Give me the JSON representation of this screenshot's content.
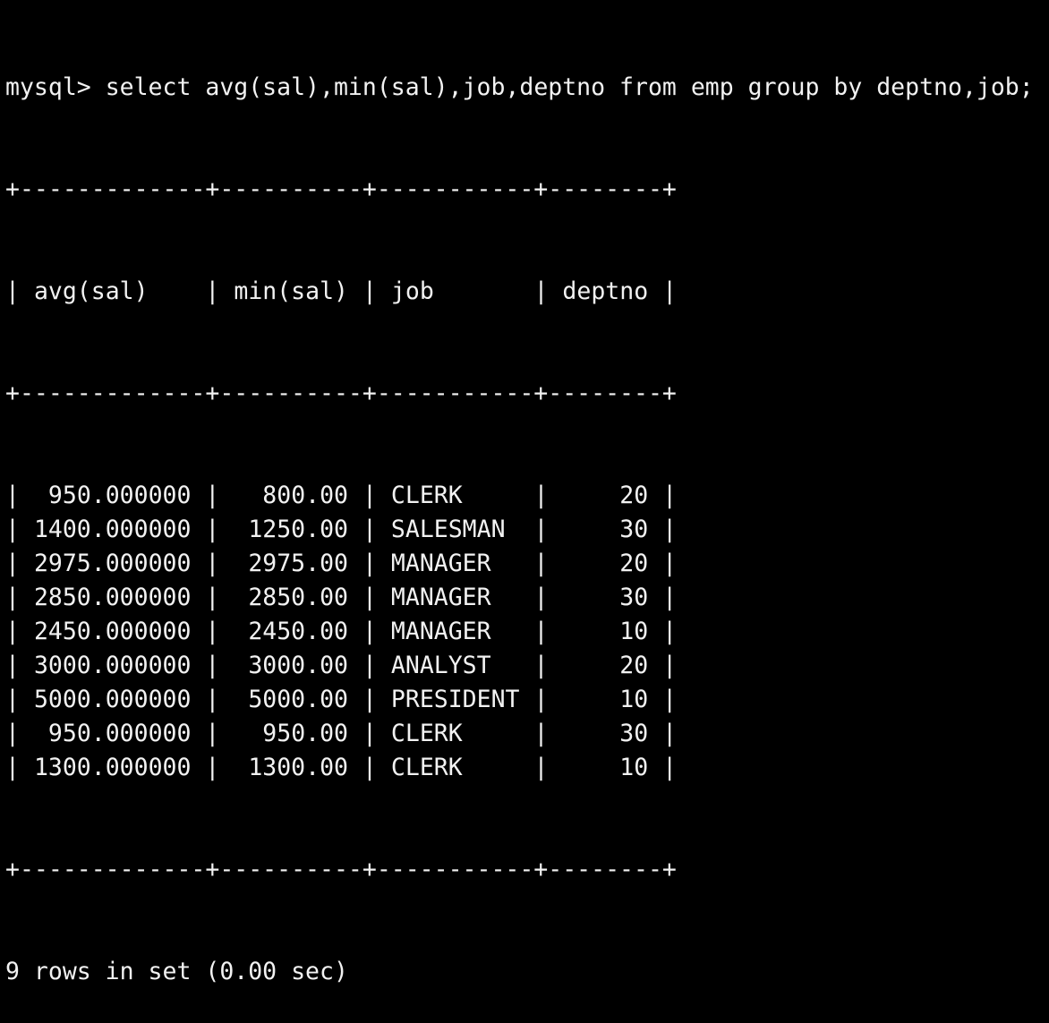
{
  "terminal": {
    "prompt": "mysql> ",
    "command": "select avg(sal),min(sal),job,deptno from emp group by deptno,job;",
    "border": "+-------------+----------+-----------+--------+",
    "columns": [
      "avg(sal)",
      "min(sal)",
      "job",
      "deptno"
    ],
    "column_widths": [
      11,
      8,
      9,
      6
    ],
    "column_align": [
      "right",
      "right",
      "left",
      "right"
    ],
    "rows": [
      [
        "950.000000",
        "800.00",
        "CLERK",
        "20"
      ],
      [
        "1400.000000",
        "1250.00",
        "SALESMAN",
        "30"
      ],
      [
        "2975.000000",
        "2975.00",
        "MANAGER",
        "20"
      ],
      [
        "2850.000000",
        "2850.00",
        "MANAGER",
        "30"
      ],
      [
        "2450.000000",
        "2450.00",
        "MANAGER",
        "10"
      ],
      [
        "3000.000000",
        "3000.00",
        "ANALYST",
        "20"
      ],
      [
        "5000.000000",
        "5000.00",
        "PRESIDENT",
        "10"
      ],
      [
        "950.000000",
        "950.00",
        "CLERK",
        "30"
      ],
      [
        "1300.000000",
        "1300.00",
        "CLERK",
        "10"
      ]
    ],
    "summary": "9 rows in set (0.00 sec)",
    "colors": {
      "background": "#000000",
      "foreground": "#f2f2f2"
    }
  }
}
